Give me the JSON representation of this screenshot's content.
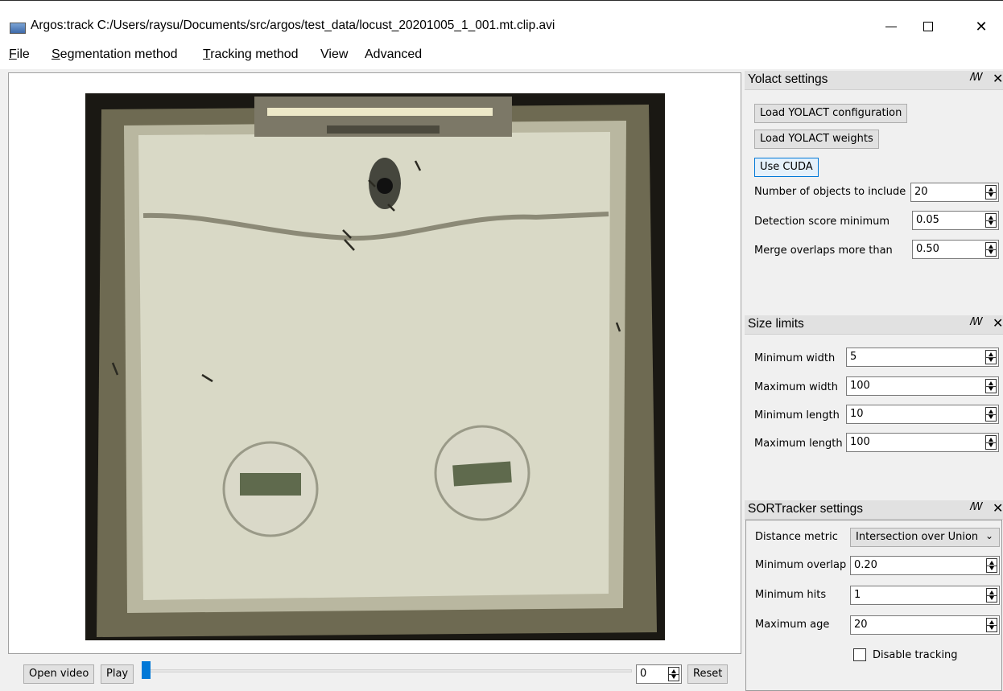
{
  "window": {
    "title": "Argos:track C:/Users/raysu/Documents/src/argos/test_data/locust_20201005_1_001.mt.clip.avi",
    "minimize_glyph": "—",
    "maximize_glyph": "☐",
    "close_glyph": "✕"
  },
  "menu": [
    {
      "prefix": "",
      "accel": "F",
      "rest": "ile"
    },
    {
      "prefix": "",
      "accel": "S",
      "rest": "egmentation method"
    },
    {
      "prefix": "",
      "accel": "T",
      "rest": "racking method"
    },
    {
      "prefix": "View",
      "accel": "",
      "rest": ""
    },
    {
      "prefix": "Advanced",
      "accel": "",
      "rest": ""
    }
  ],
  "video": {
    "icon": "video-frame-image"
  },
  "controls": {
    "open_video": "Open video",
    "play": "Play",
    "frame_value": "0",
    "reset": "Reset",
    "slider_position": 0
  },
  "yolact": {
    "title": "Yolact settings",
    "load_config": "Load YOLACT configuration",
    "load_weights": "Load YOLACT weights",
    "use_cuda": "Use CUDA",
    "num_objects_label": "Number of objects to include",
    "num_objects_value": "20",
    "score_min_label": "Detection score minimum",
    "score_min_value": "0.05",
    "merge_label": "Merge overlaps more than",
    "merge_value": "0.50"
  },
  "size_limits": {
    "title": "Size limits",
    "min_width_label": "Minimum width",
    "min_width_value": "5",
    "max_width_label": "Maximum width",
    "max_width_value": "100",
    "min_length_label": "Minimum length",
    "min_length_value": "10",
    "max_length_label": "Maximum length",
    "max_length_value": "100"
  },
  "sort": {
    "title": "SORTracker settings",
    "metric_label": "Distance metric",
    "metric_value": "Intersection over Union",
    "min_overlap_label": "Minimum overlap",
    "min_overlap_value": "0.20",
    "min_hits_label": "Minimum hits",
    "min_hits_value": "1",
    "max_age_label": "Maximum age",
    "max_age_value": "20",
    "disable_label": "Disable tracking",
    "disable_checked": false
  },
  "dock_icons": {
    "float": "ꟿ",
    "close": "✕"
  }
}
